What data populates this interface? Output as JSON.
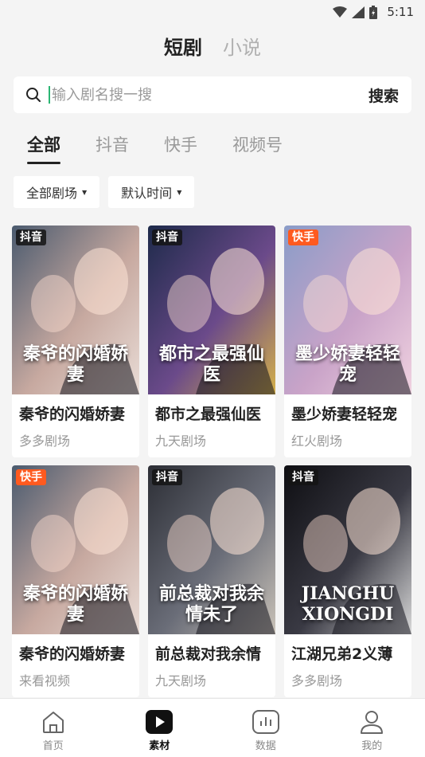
{
  "status": {
    "time": "5:11"
  },
  "top_tabs": [
    {
      "label": "短剧",
      "active": true
    },
    {
      "label": "小说",
      "active": false
    }
  ],
  "search": {
    "placeholder": "输入剧名搜一搜",
    "button": "搜索"
  },
  "category_tabs": [
    {
      "label": "全部",
      "active": true
    },
    {
      "label": "抖音",
      "active": false
    },
    {
      "label": "快手",
      "active": false
    },
    {
      "label": "视频号",
      "active": false
    }
  ],
  "filters": [
    {
      "label": "全部剧场"
    },
    {
      "label": "默认时间"
    }
  ],
  "cards": [
    {
      "badge": "抖音",
      "platform": "douyin",
      "poster_text": "秦爷的闪婚娇妻",
      "title": "秦爷的闪婚娇妻",
      "source": "多多剧场",
      "palette": [
        "#4a5a6e",
        "#c7a9a0",
        "#e9dcd6"
      ]
    },
    {
      "badge": "抖音",
      "platform": "douyin",
      "poster_text": "都市之最强仙医",
      "title": "都市之最强仙医",
      "source": "九天剧场",
      "palette": [
        "#1d2a4a",
        "#6b4a8a",
        "#d4b04a"
      ]
    },
    {
      "badge": "快手",
      "platform": "kuaishou",
      "poster_text": "墨少娇妻轻轻宠",
      "title": "墨少娇妻轻轻宠",
      "source": "红火剧场",
      "palette": [
        "#8a9cc8",
        "#c9a3c8",
        "#f0d2e0"
      ]
    },
    {
      "badge": "快手",
      "platform": "kuaishou",
      "poster_text": "秦爷的闪婚娇妻",
      "title": "秦爷的闪婚娇妻",
      "source": "来看视频",
      "palette": [
        "#4a5a6e",
        "#c7a9a0",
        "#e9dcd6"
      ]
    },
    {
      "badge": "抖音",
      "platform": "douyin",
      "poster_text": "前总裁对我余情未了",
      "title": "前总裁对我余情",
      "source": "九天剧场",
      "palette": [
        "#2c2e35",
        "#6a6d78",
        "#c9c2b8"
      ]
    },
    {
      "badge": "抖音",
      "platform": "douyin",
      "poster_text": "JIANGHU XIONGDI",
      "title": "江湖兄弟2义薄",
      "source": "多多剧场",
      "palette": [
        "#0e0e12",
        "#3a3a44",
        "#d9d9d9"
      ]
    }
  ],
  "bottom_nav": [
    {
      "label": "首页",
      "icon": "home-icon",
      "active": false
    },
    {
      "label": "素材",
      "icon": "play-icon",
      "active": true
    },
    {
      "label": "数据",
      "icon": "chart-icon",
      "active": false
    },
    {
      "label": "我的",
      "icon": "user-icon",
      "active": false
    }
  ]
}
